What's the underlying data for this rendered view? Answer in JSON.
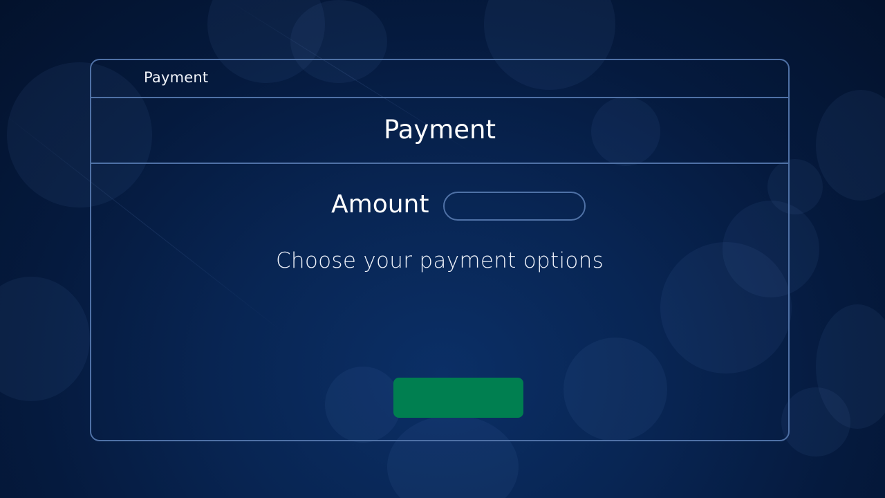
{
  "window": {
    "title": "Payment"
  },
  "header": {
    "title": "Payment"
  },
  "form": {
    "amount_label": "Amount",
    "amount_value": "",
    "amount_placeholder": "",
    "instructions": "Choose your payment options",
    "submit_label": ""
  },
  "colors": {
    "background": "#051a3e",
    "border": "#4f71a6",
    "submit_button": "#007f50",
    "text": "#ffffff"
  }
}
